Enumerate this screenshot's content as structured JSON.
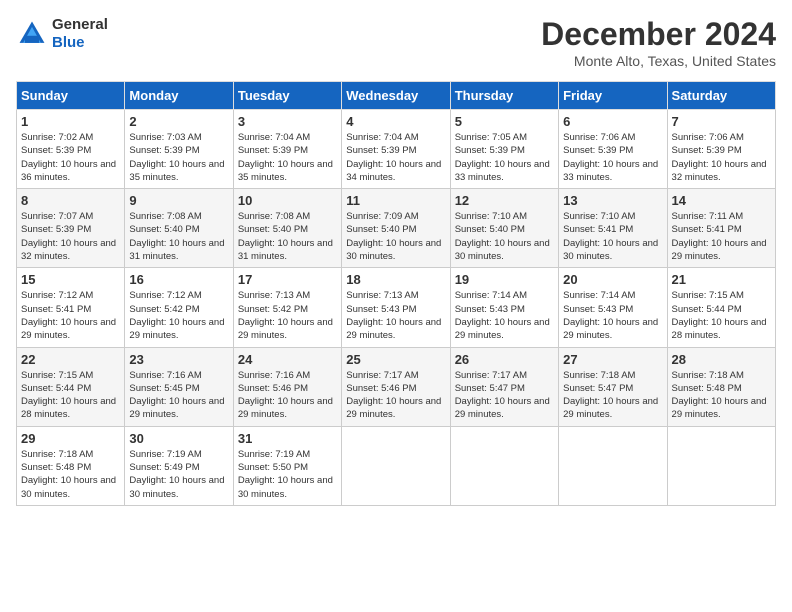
{
  "logo": {
    "line1": "General",
    "line2": "Blue"
  },
  "title": "December 2024",
  "location": "Monte Alto, Texas, United States",
  "days_of_week": [
    "Sunday",
    "Monday",
    "Tuesday",
    "Wednesday",
    "Thursday",
    "Friday",
    "Saturday"
  ],
  "weeks": [
    [
      {
        "day": 1,
        "sunrise": "7:02 AM",
        "sunset": "5:39 PM",
        "daylight": "10 hours and 36 minutes."
      },
      {
        "day": 2,
        "sunrise": "7:03 AM",
        "sunset": "5:39 PM",
        "daylight": "10 hours and 35 minutes."
      },
      {
        "day": 3,
        "sunrise": "7:04 AM",
        "sunset": "5:39 PM",
        "daylight": "10 hours and 35 minutes."
      },
      {
        "day": 4,
        "sunrise": "7:04 AM",
        "sunset": "5:39 PM",
        "daylight": "10 hours and 34 minutes."
      },
      {
        "day": 5,
        "sunrise": "7:05 AM",
        "sunset": "5:39 PM",
        "daylight": "10 hours and 33 minutes."
      },
      {
        "day": 6,
        "sunrise": "7:06 AM",
        "sunset": "5:39 PM",
        "daylight": "10 hours and 33 minutes."
      },
      {
        "day": 7,
        "sunrise": "7:06 AM",
        "sunset": "5:39 PM",
        "daylight": "10 hours and 32 minutes."
      }
    ],
    [
      {
        "day": 8,
        "sunrise": "7:07 AM",
        "sunset": "5:39 PM",
        "daylight": "10 hours and 32 minutes."
      },
      {
        "day": 9,
        "sunrise": "7:08 AM",
        "sunset": "5:40 PM",
        "daylight": "10 hours and 31 minutes."
      },
      {
        "day": 10,
        "sunrise": "7:08 AM",
        "sunset": "5:40 PM",
        "daylight": "10 hours and 31 minutes."
      },
      {
        "day": 11,
        "sunrise": "7:09 AM",
        "sunset": "5:40 PM",
        "daylight": "10 hours and 30 minutes."
      },
      {
        "day": 12,
        "sunrise": "7:10 AM",
        "sunset": "5:40 PM",
        "daylight": "10 hours and 30 minutes."
      },
      {
        "day": 13,
        "sunrise": "7:10 AM",
        "sunset": "5:41 PM",
        "daylight": "10 hours and 30 minutes."
      },
      {
        "day": 14,
        "sunrise": "7:11 AM",
        "sunset": "5:41 PM",
        "daylight": "10 hours and 29 minutes."
      }
    ],
    [
      {
        "day": 15,
        "sunrise": "7:12 AM",
        "sunset": "5:41 PM",
        "daylight": "10 hours and 29 minutes."
      },
      {
        "day": 16,
        "sunrise": "7:12 AM",
        "sunset": "5:42 PM",
        "daylight": "10 hours and 29 minutes."
      },
      {
        "day": 17,
        "sunrise": "7:13 AM",
        "sunset": "5:42 PM",
        "daylight": "10 hours and 29 minutes."
      },
      {
        "day": 18,
        "sunrise": "7:13 AM",
        "sunset": "5:43 PM",
        "daylight": "10 hours and 29 minutes."
      },
      {
        "day": 19,
        "sunrise": "7:14 AM",
        "sunset": "5:43 PM",
        "daylight": "10 hours and 29 minutes."
      },
      {
        "day": 20,
        "sunrise": "7:14 AM",
        "sunset": "5:43 PM",
        "daylight": "10 hours and 29 minutes."
      },
      {
        "day": 21,
        "sunrise": "7:15 AM",
        "sunset": "5:44 PM",
        "daylight": "10 hours and 28 minutes."
      }
    ],
    [
      {
        "day": 22,
        "sunrise": "7:15 AM",
        "sunset": "5:44 PM",
        "daylight": "10 hours and 28 minutes."
      },
      {
        "day": 23,
        "sunrise": "7:16 AM",
        "sunset": "5:45 PM",
        "daylight": "10 hours and 29 minutes."
      },
      {
        "day": 24,
        "sunrise": "7:16 AM",
        "sunset": "5:46 PM",
        "daylight": "10 hours and 29 minutes."
      },
      {
        "day": 25,
        "sunrise": "7:17 AM",
        "sunset": "5:46 PM",
        "daylight": "10 hours and 29 minutes."
      },
      {
        "day": 26,
        "sunrise": "7:17 AM",
        "sunset": "5:47 PM",
        "daylight": "10 hours and 29 minutes."
      },
      {
        "day": 27,
        "sunrise": "7:18 AM",
        "sunset": "5:47 PM",
        "daylight": "10 hours and 29 minutes."
      },
      {
        "day": 28,
        "sunrise": "7:18 AM",
        "sunset": "5:48 PM",
        "daylight": "10 hours and 29 minutes."
      }
    ],
    [
      {
        "day": 29,
        "sunrise": "7:18 AM",
        "sunset": "5:48 PM",
        "daylight": "10 hours and 30 minutes."
      },
      {
        "day": 30,
        "sunrise": "7:19 AM",
        "sunset": "5:49 PM",
        "daylight": "10 hours and 30 minutes."
      },
      {
        "day": 31,
        "sunrise": "7:19 AM",
        "sunset": "5:50 PM",
        "daylight": "10 hours and 30 minutes."
      },
      null,
      null,
      null,
      null
    ]
  ]
}
